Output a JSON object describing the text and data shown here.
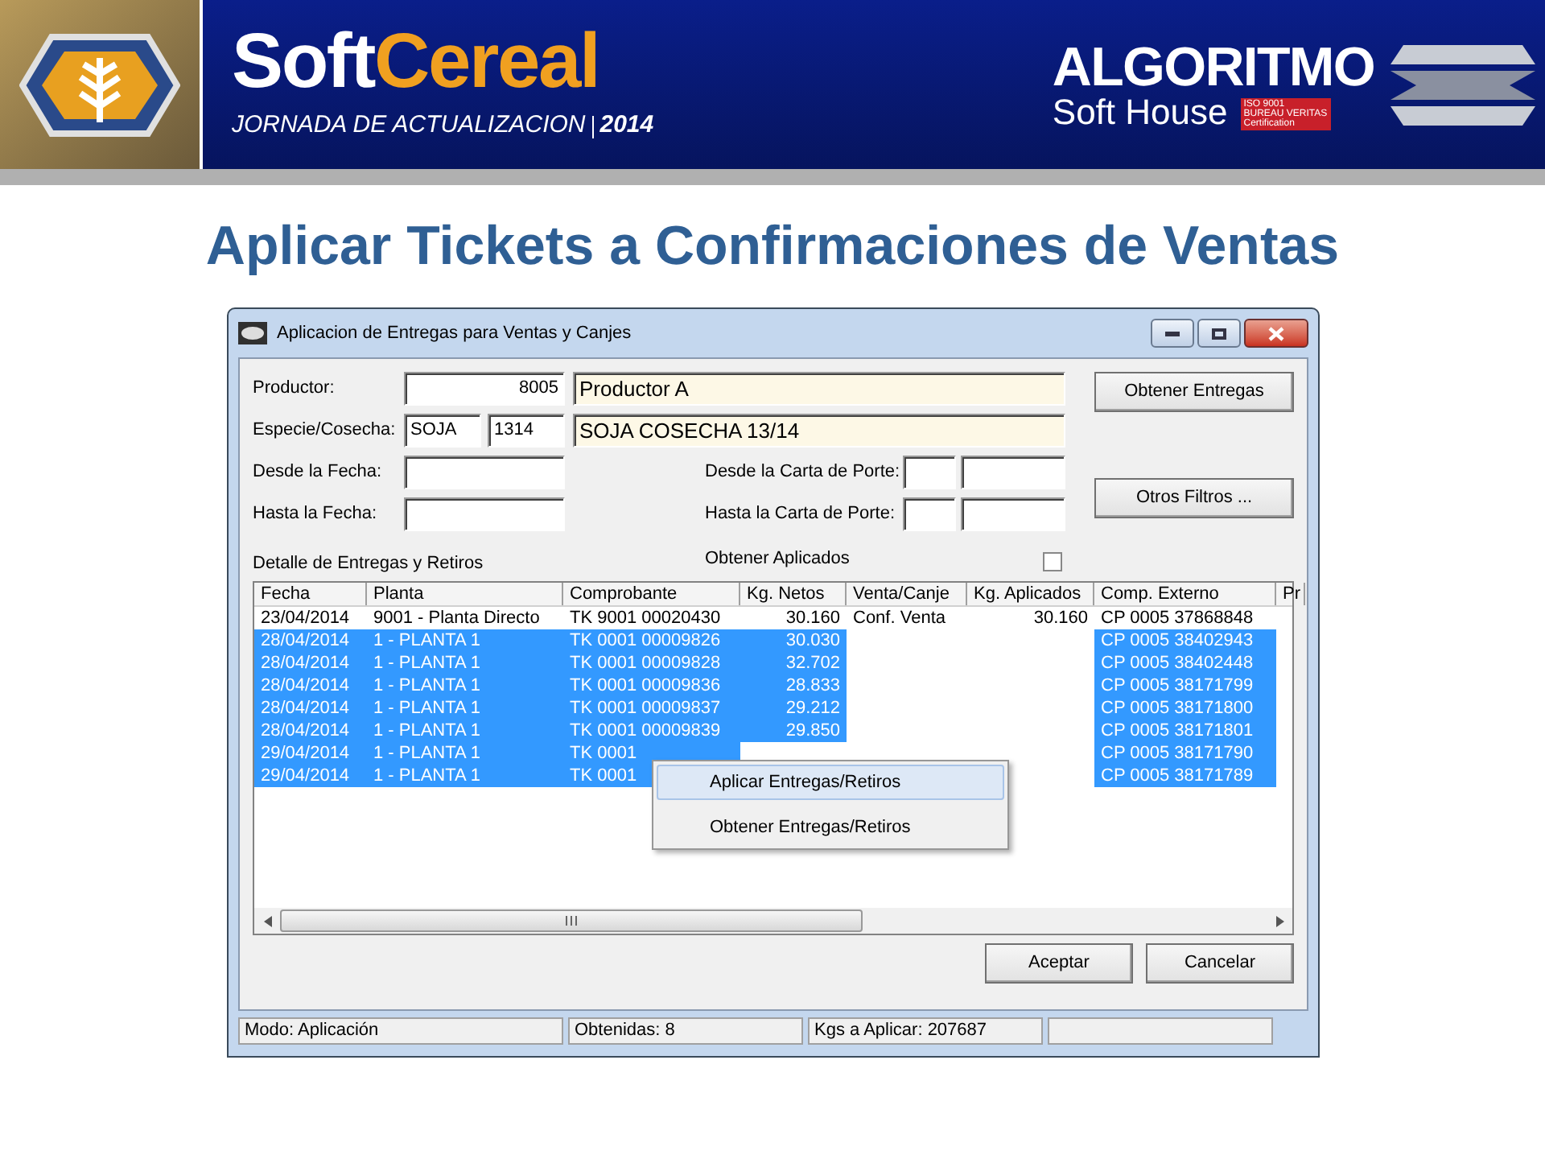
{
  "banner": {
    "brand_part1": "Soft",
    "brand_part2": "Cereal",
    "subtitle": "JORNADA DE ACTUALIZACION",
    "year": "2014",
    "company": "ALGORITMO",
    "company_sub": "Soft House",
    "cert": [
      "ISO 9001",
      "BUREAU VERITAS",
      "Certification"
    ]
  },
  "slide_title": "Aplicar Tickets a Confirmaciones de Ventas",
  "window": {
    "title": "Aplicacion de Entregas para Ventas y Canjes",
    "productor": {
      "label": "Productor:",
      "code": "8005",
      "name": "Productor A"
    },
    "especie": {
      "label": "Especie/Cosecha:",
      "especie": "SOJA",
      "cosecha": "1314",
      "name": "SOJA COSECHA 13/14"
    },
    "desde_fecha": {
      "label": "Desde la Fecha:"
    },
    "hasta_fecha": {
      "label": "Hasta la Fecha:"
    },
    "desde_carta": {
      "label": "Desde la Carta de Porte:"
    },
    "hasta_carta": {
      "label": "Hasta la Carta de Porte:"
    },
    "obtener_aplicados": {
      "label": "Obtener Aplicados",
      "checked": false
    },
    "buttons_right": [
      "Obtener Entregas",
      "Otros Filtros ..."
    ],
    "table_label": "Detalle de Entregas y Retiros",
    "table": {
      "columns": [
        "Fecha",
        "Planta",
        "Comprobante",
        "Kg. Netos",
        "Venta/Canje",
        "Kg. Aplicados",
        "Comp. Externo",
        "Pr"
      ],
      "rows": [
        {
          "selected": false,
          "cells": [
            "23/04/2014",
            "9001 - Planta Directo",
            "TK 9001 00020430",
            "30.160",
            "Conf. Venta",
            "30.160",
            "CP 0005 37868848",
            ""
          ]
        },
        {
          "selected": true,
          "cells": [
            "28/04/2014",
            "1 - PLANTA 1",
            "TK 0001 00009826",
            "30.030",
            "",
            "",
            "CP 0005 38402943",
            ""
          ]
        },
        {
          "selected": true,
          "cells": [
            "28/04/2014",
            "1 - PLANTA 1",
            "TK 0001 00009828",
            "32.702",
            "",
            "",
            "CP 0005 38402448",
            ""
          ]
        },
        {
          "selected": true,
          "cells": [
            "28/04/2014",
            "1 - PLANTA 1",
            "TK 0001 00009836",
            "28.833",
            "",
            "",
            "CP 0005 38171799",
            ""
          ]
        },
        {
          "selected": true,
          "cells": [
            "28/04/2014",
            "1 - PLANTA 1",
            "TK 0001 00009837",
            "29.212",
            "",
            "",
            "CP 0005 38171800",
            ""
          ]
        },
        {
          "selected": true,
          "cells": [
            "28/04/2014",
            "1 - PLANTA 1",
            "TK 0001 00009839",
            "29.850",
            "",
            "",
            "CP 0005 38171801",
            ""
          ]
        },
        {
          "selected": true,
          "cells": [
            "29/04/2014",
            "1 - PLANTA 1",
            "TK 0001",
            "",
            "",
            "",
            "CP 0005 38171790",
            ""
          ]
        },
        {
          "selected": true,
          "cells": [
            "29/04/2014",
            "1 - PLANTA 1",
            "TK 0001",
            "",
            "",
            "",
            "CP 0005 38171789",
            ""
          ]
        }
      ]
    },
    "context_menu": [
      {
        "label": "Aplicar Entregas/Retiros",
        "selected": true
      },
      {
        "label": "Obtener Entregas/Retiros",
        "selected": false
      }
    ],
    "buttons_bottom": [
      "Aceptar",
      "Cancelar"
    ],
    "status_bar": [
      "Modo: Aplicación",
      "Obtenidas: 8",
      "Kgs a Aplicar: 207687"
    ]
  }
}
